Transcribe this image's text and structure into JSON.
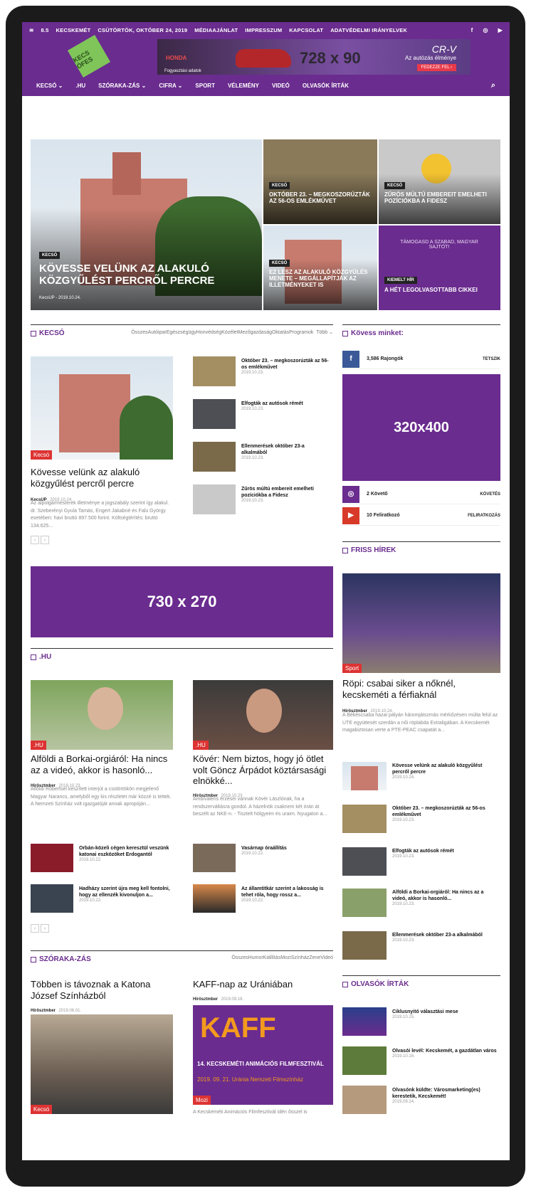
{
  "topbar": {
    "weather": "8.5",
    "unit": "c",
    "city": "KECSKEMÉT",
    "date": "CSÜTÖRTÖK, OKTÓBER 24, 2019",
    "links": [
      "MÉDIAAJÁNLAT",
      "IMPRESSZUM",
      "KAPCSOLAT",
      "ADATVÉDELMI IRÁNYELVEK"
    ],
    "social_icons": [
      "facebook-icon",
      "instagram-icon",
      "youtube-icon"
    ]
  },
  "logo_text": "KECS ÓFES",
  "ad_top": {
    "brand": "HONDA",
    "size": "728 x 90",
    "model": "CR-V",
    "tagline": "Az autózás élménye",
    "button": "FEDEZZE FEL ›",
    "note": "Fogyasztási adatok"
  },
  "nav": [
    "KECSÓ ⌄",
    ".HU",
    "SZÓRAKA-ZÁS ⌄",
    "CIFRA ⌄",
    "SPORT",
    "VÉLEMÉNY",
    "VIDEÓ",
    "OLVASÓK ÍRTÁK"
  ],
  "hero": {
    "main": {
      "cat": "KECSÓ",
      "title": "KÖVESSE VELÜNK AZ ALAKULÓ KÖZGYŰLÉST PERCRŐL PERCRE",
      "meta": "KecsUP - 2019.10.24."
    },
    "t1": {
      "cat": "KECSÓ",
      "title": "OKTÓBER 23. – MEGKOSZORÚZTÁK AZ 56-OS EMLÉKMŰVET"
    },
    "t2": {
      "cat": "KECSÓ",
      "title": "ZŰRÖS MÚLTÚ EMBEREIT EMELHETI POZÍCIÓKBA A FIDESZ"
    },
    "t3": {
      "cat": "KECSÓ",
      "title": "EZ LESZ AZ ALAKULÓ KÖZGYŰLÉS MENETE – MEGÁLLAPÍTJÁK AZ ILLETMÉNYEKET IS"
    },
    "t4": {
      "cat": "KIEMELT HÍR",
      "title": "A HÉT LEGOLVASOTTABB CIKKEI",
      "poster": "TÁMOGASD A SZABAD, MAGYAR SAJTÓT!"
    }
  },
  "kecso": {
    "label": "KECSÓ",
    "filters": "ÖsszesAutóiparEgészségügyHonvédségKözéletMezőgazdaságOktatásProgramok",
    "more": "Több ⌄",
    "main": {
      "badge": "Kecsó",
      "title": "Kövesse velünk az alakuló közgyűlést percről percre",
      "author": "KecsUP",
      "date": "2019.10.24.",
      "excerpt": "Az alpolgármesterek illetménye a jogszabály szerint így alakul. dr. Szeberényi Gyula Tamás, Engert Jakabné és Falu György esetében: havi bruttó 897.500 forint. Költségtérítés: bruttó 134.625..."
    },
    "list": [
      {
        "title": "Október 23. – megkoszorúzták az 56-os emlékművet",
        "date": "2019.10.23."
      },
      {
        "title": "Elfogták az autósok rémét",
        "date": "2019.10.23."
      },
      {
        "title": "Ellenmerések október 23-a alkalmából",
        "date": "2019.10.23."
      },
      {
        "title": "Zűrös múltú embereit emelheti pozíciókba a Fidesz",
        "date": "2019.10.23."
      }
    ]
  },
  "ad_mid": "730 x 270",
  "follow": {
    "label": "Kövess minket:",
    "rows": [
      {
        "icon": "facebook-icon",
        "count": "3,586",
        "name": "Rajongók",
        "action": "TETSZIK"
      },
      {
        "icon": "instagram-icon",
        "count": "2",
        "name": "Követő",
        "action": "KÖVETÉS"
      },
      {
        "icon": "youtube-icon",
        "count": "10",
        "name": "Feliratkozó",
        "action": "FELIRATKOZÁS"
      }
    ],
    "ad": "320x400"
  },
  "hu": {
    "label": ".HU",
    "a1": {
      "badge": ".HU",
      "title": "Alföldi a Borkai-orgiáról: Ha nincs az a videó, akkor is hasonló...",
      "author": "Hírösztmber",
      "date": "2019.10.23.",
      "excerpt": "Alföldi Róbertsel készített interjút a csütörtökön megjelenő Magyar Narancs, amelyből egy kis részletet már közzé is tettek. A Nemzeti Színház volt igazgatóját annak apropóján..."
    },
    "a2": {
      "badge": ".HU",
      "title": "Kövér: Nem biztos, hogy jó ötlet volt Göncz Árpádot köztársasági elnökké...",
      "author": "Hírösztmber",
      "date": "2019.10.23.",
      "excerpt": "Ambivalens érzései vannak Kövér Lászlónak, ha a rendszerváltásra gondol. A házelnök csaknem két órán át beszélt az NKE-n. - Tisztelt hölgyeim és uraim. Nyugaton a..."
    },
    "small": [
      {
        "title": "Orbán-közeli cégen keresztül veszünk katonai eszközöket Erdogantól",
        "date": "2019.10.22."
      },
      {
        "title": "Vasárnap óraállítás",
        "date": "2019.10.22."
      },
      {
        "title": "Hadházy szerint újra meg kell fontolni, hogy az ellenzék kivonuljon a...",
        "date": "2019.10.22."
      },
      {
        "title": "Az államtitkár szerint a lakosság is tehet róla, hogy rossz a...",
        "date": "2019.10.22."
      }
    ]
  },
  "friss": {
    "label": "FRISS HÍREK",
    "main": {
      "badge": "Sport",
      "title": "Röpi: csabai siker a nőknél, kecskeméti a férfiaknál",
      "author": "Hírösztmber",
      "date": "2019.10.24.",
      "excerpt": "A Békéscsaba hazai pályán háromjátszmás mérkőzésen múlta felül az UTE együttesét szerdán a női röplabda Extraligában. A Kecskemét magabiztosan verte a PTE-PEAC csapatát a..."
    },
    "list": [
      {
        "title": "Kövesse velünk az alakuló közgyűlést percről percre",
        "date": "2019.10.24."
      },
      {
        "title": "Október 23. – megkoszorúzták az 56-os emlékművet",
        "date": "2019.10.23."
      },
      {
        "title": "Elfogták az autósok rémét",
        "date": "2019.10.23."
      },
      {
        "title": "Alföldi a Borkai-orgiáról: Ha nincs az a videó, akkor is hasonló...",
        "date": "2019.10.23."
      },
      {
        "title": "Ellenmerések október 23-a alkalmából",
        "date": "2019.10.23."
      }
    ]
  },
  "szoraka": {
    "label": "SZÓRAKA-ZÁS",
    "filters": "ÖsszesHumorKiállításMoziSzínházZeneVideó",
    "a1": {
      "title": "Többen is távoznak a Katona József Színházból",
      "author": "Hírösztmber",
      "date": "2019.06.01.",
      "badge": "Kecsó"
    },
    "a2": {
      "title": "KAFF-nap az Urániában",
      "author": "Hírösztmber",
      "date": "2019.09.18.",
      "badge": "Mozi",
      "poster_title": "KAFF",
      "poster_sub": "14. KECSKEMÉTI ANIMÁCIÓS FILMFESZTIVÁL",
      "poster_date": "2019. 09. 21. Uránia Nemzeti Filmszínház",
      "excerpt": "A Kecskeméti Animációs Filmfesztivál idén ősszel is"
    }
  },
  "olvasok": {
    "label": "OLVASÓK ÍRTÁK",
    "list": [
      {
        "title": "Ciklusnyitó választási mese",
        "date": "2019.10.15."
      },
      {
        "title": "Olvasói levél: Kecskemét, a gazdátlan város",
        "date": "2019.10.16."
      },
      {
        "title": "Olvasónk küldte: Városmarketing(es) kerestetik, Kecskemét!",
        "date": "2019.09.14."
      }
    ]
  }
}
